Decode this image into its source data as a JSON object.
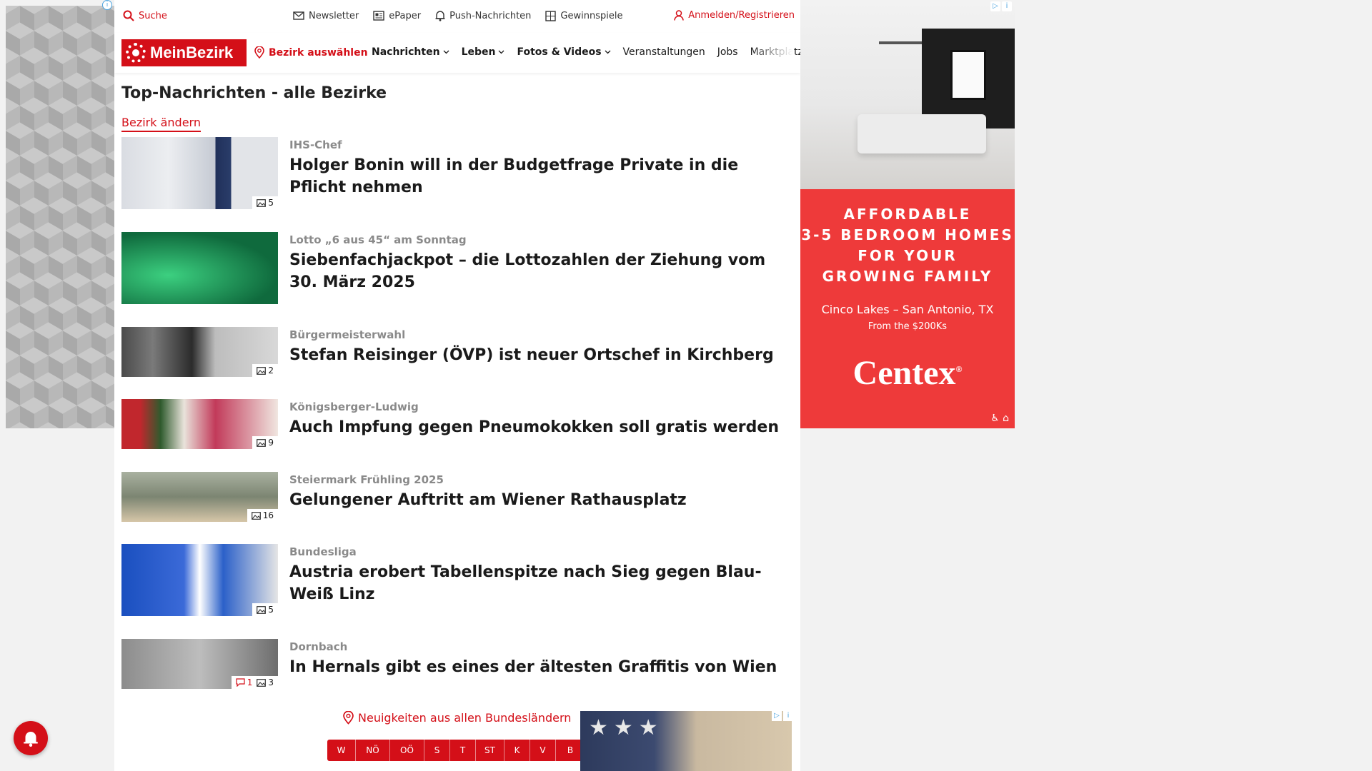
{
  "topbar": {
    "search_label": "Suche",
    "links": [
      {
        "label": "Newsletter",
        "icon": "mail-icon"
      },
      {
        "label": "ePaper",
        "icon": "newspaper-icon"
      },
      {
        "label": "Push-Nachrichten",
        "icon": "bell-icon"
      },
      {
        "label": "Gewinnspiele",
        "icon": "gift-icon"
      }
    ],
    "login_label": "Anmelden/Registrieren"
  },
  "navbar": {
    "logo_text": "MeinBezirk",
    "bezirk_select": "Bezirk auswählen",
    "menu": [
      {
        "label": "Nachrichten",
        "dropdown": true
      },
      {
        "label": "Leben",
        "dropdown": true
      },
      {
        "label": "Fotos & Videos",
        "dropdown": true
      },
      {
        "label": "Veranstaltungen",
        "dropdown": false
      },
      {
        "label": "Jobs",
        "dropdown": false
      },
      {
        "label": "Marktplatz",
        "dropdown": false
      }
    ]
  },
  "page": {
    "title": "Top-Nachrichten - alle Bezirke",
    "change_bezirk": "Bezirk ändern"
  },
  "articles": [
    {
      "kicker": "IHS-Chef",
      "headline": "Holger Bonin will in der Budgetfrage Private in die Pflicht nehmen",
      "photos": "5",
      "comments": ""
    },
    {
      "kicker": "Lotto „6 aus 45“ am Sonntag",
      "headline": "Siebenfachjackpot – die Lottozahlen der Ziehung vom 30. März 2025",
      "photos": "",
      "comments": ""
    },
    {
      "kicker": "Bürgermeisterwahl",
      "headline": "Stefan Reisinger (ÖVP) ist neuer Ortschef in Kirchberg",
      "photos": "2",
      "comments": ""
    },
    {
      "kicker": "Königsberger-Ludwig",
      "headline": "Auch Impfung gegen Pneumokokken soll gratis werden",
      "photos": "9",
      "comments": ""
    },
    {
      "kicker": "Steiermark Frühling 2025",
      "headline": "Gelungener Auftritt am Wiener Rathausplatz",
      "photos": "16",
      "comments": ""
    },
    {
      "kicker": "Bundesliga",
      "headline": "Austria erobert Tabellenspitze nach Sieg gegen Blau-Weiß Linz",
      "photos": "5",
      "comments": ""
    },
    {
      "kicker": "Dornbach",
      "headline": "In Hernals gibt es eines der ältesten Graffitis von Wien",
      "photos": "3",
      "comments": "1"
    }
  ],
  "bottom": {
    "states_link": "Neuigkeiten aus allen Bundesländern",
    "states": [
      "W",
      "NÖ",
      "OÖ",
      "S",
      "T",
      "ST",
      "K",
      "V",
      "B"
    ]
  },
  "ad_right": {
    "headline_lines": [
      "AFFORDABLE",
      "3-5 BEDROOM HOMES",
      "FOR YOUR",
      "GROWING FAMILY"
    ],
    "location": "Cinco Lakes – San Antonio, TX",
    "price": "From the $200Ks",
    "brand": "Centex",
    "brand_mark": "®"
  },
  "colors": {
    "accent": "#d40f18",
    "ad_red": "#ee3a3a"
  }
}
